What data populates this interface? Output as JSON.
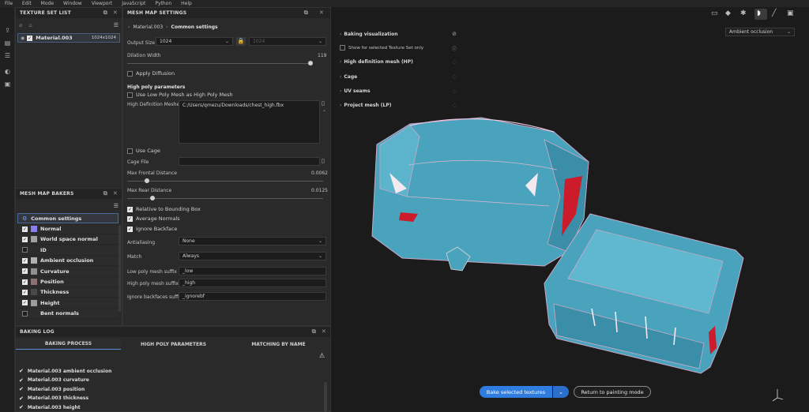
{
  "menu": [
    "File",
    "Edit",
    "Mode",
    "Window",
    "Viewport",
    "JavaScript",
    "Python",
    "Help"
  ],
  "texture_set_list": {
    "title": "TEXTURE SET LIST",
    "item": {
      "name": "Material.003",
      "size": "1024x1024"
    }
  },
  "mesh_map_settings": {
    "title": "MESH MAP SETTINGS",
    "breadcrumb_root": "Material.003",
    "breadcrumb_current": "Common settings",
    "output_size_label": "Output Size",
    "output_size_value": "1024",
    "output_size_linked": "1024",
    "dilation_label": "Dilation Width",
    "dilation_value": "119",
    "dilation_fraction": 0.99,
    "apply_diffusion": "Apply Diffusion",
    "high_poly_heading": "High poly parameters",
    "use_low_poly": "Use Low Poly Mesh as High Poly Mesh",
    "hd_meshes_label": "High Definition Meshes",
    "hd_meshes_value": "C:/Users/qmezu/Downloads/chest_high.fbx",
    "use_cage": "Use Cage",
    "cage_file": "Cage File",
    "max_frontal_label": "Max Frontal Distance",
    "max_frontal_value": "0.0062",
    "max_frontal_fraction": 0.1,
    "max_rear_label": "Max Rear Distance",
    "max_rear_value": "0.0125",
    "max_rear_fraction": 0.13,
    "relative_bbox": "Relative to Bounding Box",
    "average_normals": "Average Normals",
    "ignore_backface": "Ignore Backface",
    "antialiasing_label": "Antialiasing",
    "antialiasing_value": "None",
    "match_label": "Match",
    "match_value": "Always",
    "low_suffix_label": "Low poly mesh suffix",
    "low_suffix_value": "_low",
    "high_suffix_label": "High poly mesh suffix",
    "high_suffix_value": "_high",
    "ignore_suffix_label": "Ignore backfaces suffix",
    "ignore_suffix_value": "_ignorebf"
  },
  "mesh_map_bakers": {
    "title": "MESH MAP BAKERS",
    "common": "Common settings",
    "items": [
      {
        "label": "Normal",
        "checked": true,
        "color": "#8a7ff0"
      },
      {
        "label": "World space normal",
        "checked": true,
        "color": "#a0a0a0"
      },
      {
        "label": "ID",
        "checked": false,
        "color": "#2c2c2c"
      },
      {
        "label": "Ambient occlusion",
        "checked": true,
        "color": "#b0b0b0"
      },
      {
        "label": "Curvature",
        "checked": true,
        "color": "#909090"
      },
      {
        "label": "Position",
        "checked": true,
        "color": "#8c6f6f"
      },
      {
        "label": "Thickness",
        "checked": true,
        "color": "#4a4a4a"
      },
      {
        "label": "Height",
        "checked": true,
        "color": "#9a9a9a"
      },
      {
        "label": "Bent normals",
        "checked": false,
        "color": "#2c2c2c"
      }
    ]
  },
  "baking_log": {
    "title": "BAKING LOG",
    "tabs": [
      "BAKING PROCESS",
      "HIGH POLY PARAMETERS",
      "MATCHING BY NAME"
    ],
    "entries": [
      "Material.003 ambient occlusion",
      "Material.003 curvature",
      "Material.003 position",
      "Material.003 thickness",
      "Material.003 height"
    ]
  },
  "viewport": {
    "display_mode": "Ambient occlusion",
    "baking_viz": "Baking visualization",
    "show_selected": "Show for selected Texture Set only",
    "sections": [
      "High definition mesh (HP)",
      "Cage",
      "UV seams",
      "Project mesh (LP)"
    ],
    "bake_button": "Bake selected textures",
    "return_button": "Return to painting mode"
  }
}
